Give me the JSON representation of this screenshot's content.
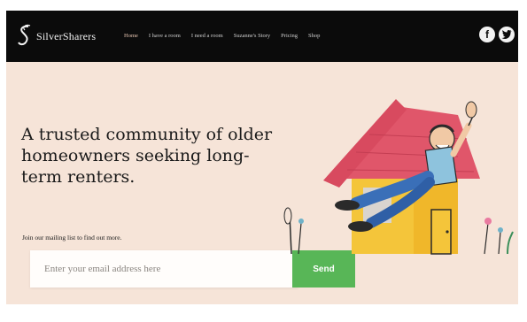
{
  "header": {
    "brand": "SilverSharers",
    "nav": [
      {
        "label": "Home",
        "active": true
      },
      {
        "label": "I have a room"
      },
      {
        "label": "I need a room"
      },
      {
        "label": "Suzanne's Story"
      },
      {
        "label": "Pricing"
      },
      {
        "label": "Shop"
      }
    ],
    "social_icons": [
      "facebook-icon",
      "twitter-icon"
    ]
  },
  "hero": {
    "headline": "A trusted community of older homeowners seeking long-term renters.",
    "mailing_prompt": "Join our mailing list to find out more.",
    "email_placeholder": "Enter your email address here",
    "send_label": "Send"
  },
  "colors": {
    "nav_bg": "#0b0b0b",
    "page_bg": "#f6e4d8",
    "send_button": "#58b657",
    "roof": "#e0566a",
    "house": "#f4c53a"
  }
}
